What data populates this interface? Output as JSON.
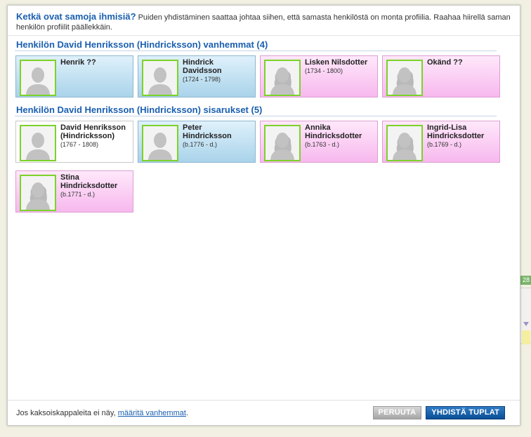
{
  "background": {
    "tab_text": "28"
  },
  "dialog": {
    "title": "Ketkä ovat samoja ihmisiä?",
    "description": "Puiden yhdistäminen saattaa johtaa siihen, että samasta henkilöstä on monta profiilia. Raahaa hiirellä saman henkilön profiilit päällekkäin."
  },
  "sections": {
    "parents": {
      "title": "Henkilön David Henriksson (Hindricksson) vanhemmat (4)",
      "people": [
        {
          "name": "Henrik ??",
          "dates": "",
          "gender": "male"
        },
        {
          "name": "Hindrick Davidsson",
          "dates": "(1724 - 1798)",
          "gender": "male"
        },
        {
          "name": "Lisken Nilsdotter",
          "dates": "(1734 - 1800)",
          "gender": "female"
        },
        {
          "name": "Okänd ??",
          "dates": "",
          "gender": "female"
        }
      ]
    },
    "siblings": {
      "title": "Henkilön David Henriksson (Hindricksson) sisarukset (5)",
      "people": [
        {
          "name": "David Henriksson (Hindricksson)",
          "dates": "(1767 - 1808)",
          "gender": "neutral"
        },
        {
          "name": "Peter Hindricksson",
          "dates": "(b.1776 - d.)",
          "gender": "male"
        },
        {
          "name": "Annika Hindricksdotter",
          "dates": "(b.1763 - d.)",
          "gender": "female"
        },
        {
          "name": "Ingrid-Lisa Hindricksdotter",
          "dates": "(b.1769 - d.)",
          "gender": "female"
        },
        {
          "name": "Stina Hindricksdotter",
          "dates": "(b.1771 - d.)",
          "gender": "female"
        }
      ]
    }
  },
  "footer": {
    "text": "Jos kaksoiskappaleita ei näy,",
    "link": "määritä vanhemmat",
    "period": ".",
    "cancel_label": "PERUUTA",
    "merge_label": "YHDISTÄ TUPLAT"
  },
  "colors": {
    "accent": "#1a5fb0",
    "male_card": "#a9d3ea",
    "female_card": "#f7b8ee",
    "avatar_border": "#7cd229"
  },
  "icons": {
    "avatar": "person-silhouette-icon"
  }
}
